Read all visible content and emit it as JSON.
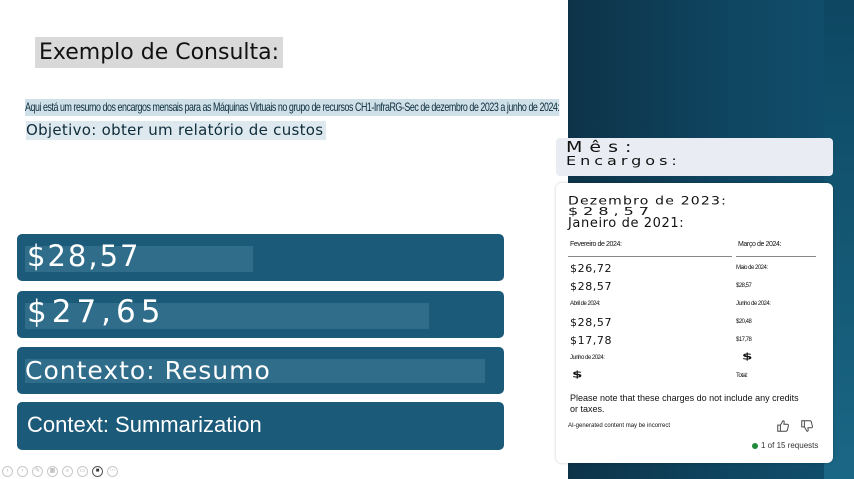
{
  "slide": {
    "title": "Exemplo de Consulta:",
    "summary_line": "Aqui está um resumo dos encargos mensais para as Máquinas Virtuais no grupo de recursos CH1-InfraRG-Sec de dezembro de 2023 a junho de 2024:",
    "objective": "Objetivo: obter um relatório de custos",
    "bars": [
      "$28,57",
      "$27,65",
      "Contexto: Resumo",
      "Context: Summarization"
    ]
  },
  "chat": {
    "header_line1": "Mês:",
    "header_line2": "Encargos:",
    "dezembro_label": "Dezembro de 2023:",
    "dezembro_value": "$28,57",
    "janeiro_label": "Janeiro de 2021:",
    "col_left_head": "Fevereiro de 2024:",
    "col_right_head": "Março de 2024:",
    "rows_left": [
      "$26,72",
      "$28,57",
      "Abril de 2024:",
      "$28,57",
      "$17,78",
      "Junho de 2024:",
      "$"
    ],
    "rows_right": [
      "Maio de 2024:",
      "$28,57",
      "Junho de 2024:",
      "$20,48",
      "$17,78",
      "$",
      "Total:"
    ],
    "note": "Please note that these charges do not include any credits or taxes.",
    "disclaimer": "AI-generated content may be incorrect",
    "requests": "1 of 15 requests"
  },
  "toolbar_icons": [
    "prev-icon",
    "next-icon",
    "pen-icon",
    "grid-icon",
    "zoom-icon",
    "subtitles-icon",
    "camera-icon",
    "more-icon"
  ]
}
